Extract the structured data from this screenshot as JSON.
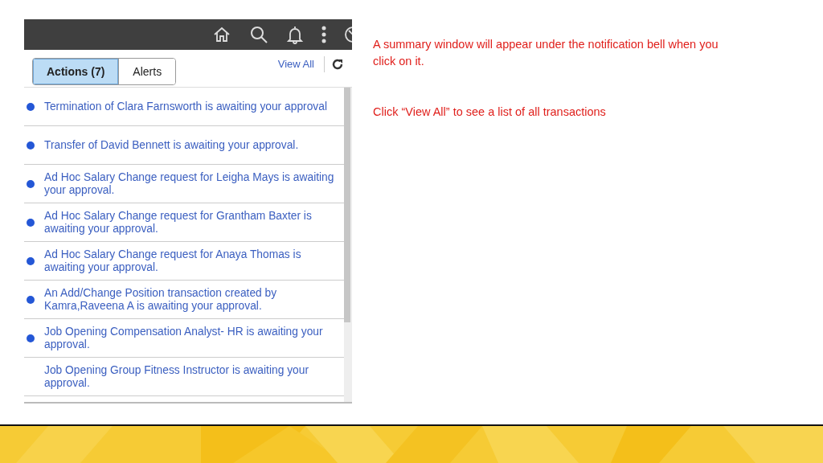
{
  "tabs": [
    {
      "label": "Actions (7)",
      "selected": true
    },
    {
      "label": "Alerts",
      "selected": false
    }
  ],
  "view_all": "View All",
  "notifications": [
    {
      "text": "Termination of Clara Farnsworth is awaiting your approval",
      "unread": true
    },
    {
      "text": "Transfer of David Bennett is awaiting your approval.",
      "unread": true
    },
    {
      "text": "Ad Hoc Salary Change request for Leigha Mays is awaiting your approval.",
      "unread": true
    },
    {
      "text": "Ad Hoc Salary Change request for Grantham Baxter is awaiting your approval.",
      "unread": true
    },
    {
      "text": "Ad Hoc Salary Change request for Anaya Thomas is awaiting your approval.",
      "unread": true
    },
    {
      "text": "An Add/Change Position transaction created by Kamra,Raveena A is awaiting your approval.",
      "unread": true
    },
    {
      "text": "Job Opening Compensation Analyst- HR is awaiting your approval.",
      "unread": true
    },
    {
      "text": "Job Opening Group Fitness Instructor is awaiting your approval.",
      "unread": false
    }
  ],
  "notes": [
    "A summary window will appear under the notification bell when you click on it.",
    "Click “View All” to see a list of all transactions"
  ]
}
